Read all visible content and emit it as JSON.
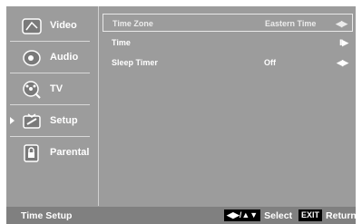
{
  "sidebar": {
    "items": [
      {
        "label": "Video",
        "icon": "video-icon"
      },
      {
        "label": "Audio",
        "icon": "audio-icon"
      },
      {
        "label": "TV",
        "icon": "tv-icon"
      },
      {
        "label": "Setup",
        "icon": "setup-icon"
      },
      {
        "label": "Parental",
        "icon": "parental-icon"
      }
    ],
    "selected_index": 3
  },
  "settings": [
    {
      "label": "Time Zone",
      "value": "Eastern Time",
      "control": "◀▶"
    },
    {
      "label": "Time",
      "value": "",
      "control": "II▶"
    },
    {
      "label": "Sleep Timer",
      "value": "Off",
      "control": "◀▶"
    }
  ],
  "footer": {
    "title": "Time Setup",
    "select_key": "◀▶/▲▼",
    "select_label": "Select",
    "exit_key": "EXIT",
    "exit_label": "Return"
  },
  "colors": {
    "background": "#9c9c9c",
    "footer": "#808080",
    "text": "#ffffff"
  }
}
